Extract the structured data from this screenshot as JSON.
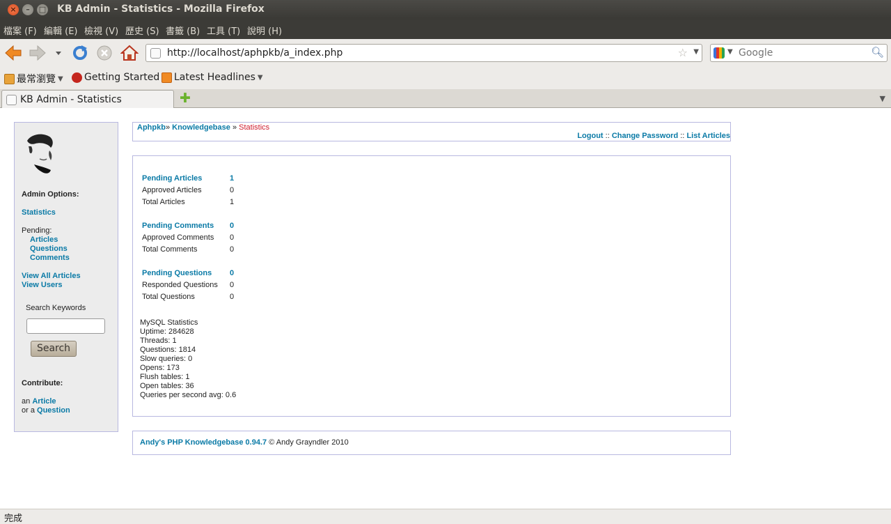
{
  "window": {
    "title": "KB Admin - Statistics - Mozilla Firefox"
  },
  "menu": [
    "檔案 (F)",
    "編輯 (E)",
    "檢視 (V)",
    "歷史 (S)",
    "書籤 (B)",
    "工具 (T)",
    "說明 (H)"
  ],
  "nav": {
    "url": "http://localhost/aphpkb/a_index.php",
    "search_placeholder": "Google"
  },
  "bookmarks": [
    "最常瀏覽",
    "Getting Started",
    "Latest Headlines"
  ],
  "tab": {
    "title": "KB Admin - Statistics"
  },
  "sidebar": {
    "admin_options": "Admin Options:",
    "statistics": "Statistics",
    "pending": "Pending:",
    "pending_items": [
      "Articles",
      "Questions",
      "Comments"
    ],
    "view_all_articles": "View All Articles",
    "view_users": "View Users",
    "search_keywords": "Search Keywords",
    "search_button": "Search",
    "contribute": "Contribute:",
    "an": "an",
    "article": "Article",
    "or_a": "or a",
    "question": "Question"
  },
  "breadcrumb": {
    "home": "Aphpkb",
    "sep1": "»",
    "kb": "Knowledgebase",
    "sep2": "»",
    "current": "Statistics"
  },
  "toplinks": {
    "logout": "Logout",
    "sep": "::",
    "change_password": "Change Password",
    "list_articles": "List Articles"
  },
  "stats": {
    "articles": [
      {
        "label": "Pending Articles",
        "value": "1"
      },
      {
        "label": "Approved Articles",
        "value": "0"
      },
      {
        "label": "Total Articles",
        "value": "1"
      }
    ],
    "comments": [
      {
        "label": "Pending Comments",
        "value": "0"
      },
      {
        "label": "Approved Comments",
        "value": "0"
      },
      {
        "label": "Total Comments",
        "value": "0"
      }
    ],
    "questions": [
      {
        "label": "Pending Questions",
        "value": "0"
      },
      {
        "label": "Responded Questions",
        "value": "0"
      },
      {
        "label": "Total Questions",
        "value": "0"
      }
    ]
  },
  "mysql": [
    "MySQL Statistics",
    "Uptime: 284628",
    "Threads: 1",
    "Questions: 1814",
    "Slow queries: 0",
    "Opens: 173",
    "Flush tables: 1",
    "Open tables: 36",
    "Queries per second avg: 0.6"
  ],
  "footer": {
    "link": "Andy's PHP Knowledgebase 0.94.7",
    "copyright": "© Andy Grayndler 2010"
  },
  "status": "完成"
}
